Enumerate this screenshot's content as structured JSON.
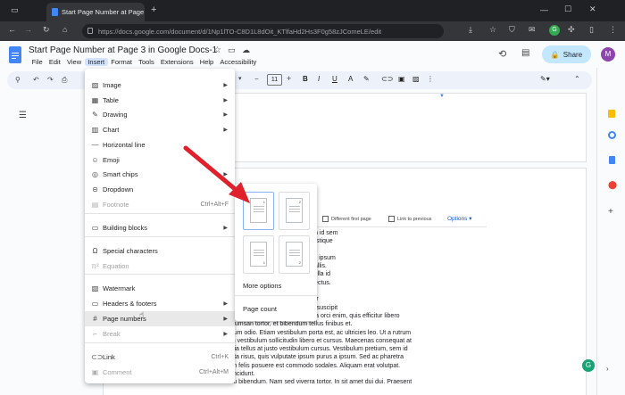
{
  "browser": {
    "tab_title": "Start Page Number at Page 3 in",
    "url": "https://docs.google.com/document/d/1Np1lTO-C8D1L8dOit_KTlfaHd2Hs3F0g58zJComeLE/edit"
  },
  "docs": {
    "title": "Start Page Number at Page 3 in Google Docs-1",
    "share_label": "Share",
    "avatar_letter": "M",
    "font_size": "11",
    "menus": [
      "File",
      "Edit",
      "View",
      "Insert",
      "Format",
      "Tools",
      "Extensions",
      "Help",
      "Accessibility"
    ]
  },
  "insert_menu": {
    "items": [
      {
        "label": "Image",
        "icon": "image-icon",
        "submenu": true
      },
      {
        "label": "Table",
        "icon": "table-icon",
        "submenu": true
      },
      {
        "label": "Drawing",
        "icon": "drawing-icon",
        "submenu": true
      },
      {
        "label": "Chart",
        "icon": "chart-icon",
        "submenu": true
      },
      {
        "label": "Horizontal line",
        "icon": "horizontal-line-icon"
      },
      {
        "label": "Emoji",
        "icon": "emoji-icon"
      },
      {
        "label": "Smart chips",
        "icon": "smart-chips-icon",
        "submenu": true
      },
      {
        "label": "Dropdown",
        "icon": "dropdown-icon"
      },
      {
        "label": "Footnote",
        "icon": "footnote-icon",
        "shortcut": "Ctrl+Alt+F",
        "disabled": true
      },
      {
        "label": "Building blocks",
        "icon": "building-blocks-icon",
        "submenu": true
      },
      {
        "label": "Special characters",
        "icon": "omega-icon"
      },
      {
        "label": "Equation",
        "icon": "equation-icon",
        "disabled": true
      },
      {
        "label": "Watermark",
        "icon": "watermark-icon"
      },
      {
        "label": "Headers & footers",
        "icon": "headers-footers-icon",
        "submenu": true
      },
      {
        "label": "Page numbers",
        "icon": "page-numbers-icon",
        "submenu": true,
        "highlighted": true
      },
      {
        "label": "Break",
        "icon": "break-icon",
        "submenu": true,
        "disabled": true
      },
      {
        "label": "Link",
        "icon": "link-icon",
        "shortcut": "Ctrl+K"
      },
      {
        "label": "Comment",
        "icon": "comment-icon",
        "shortcut": "Ctrl+Alt+M",
        "disabled": true
      }
    ]
  },
  "page_numbers_submenu": {
    "more_options": "More options",
    "page_count": "Page count"
  },
  "header_bar": {
    "different_first_page": "Different first page",
    "link_to_previous": "Link to previous",
    "options": "Options"
  },
  "body_lines": [
    "n at nulla tempor ornare. Aenean id sem",
    "molestie non ante non, iaculis tristique",
    "ellentesque, nisi quis sodales",
    "quam nec justo. Vestibulum ante ipsum",
    "rae; Etiam efficitur congue convallis.",
    "volutpat. Aenean consectetur, nulla id",
    "nibh lacus at libero. In nec orci lectus.",
    "lorem auctor sodales. Quisque a",
    "ipsum dolor sit amet, consectetur",
    "consequat nisl accumsan. Proin suscipit",
    "n lorem facilisis. Phasellus viverra orci enim, quis efficitur libero",
    "accumsan tortor, et bibendum tellus finibus et.",
    "entum odio. Etiam vestibulum porta est, ac ultricies leo. Ut a rutrum",
    "ean vestibulum sollicitudin libero et cursus. Maecenas consequat at",
    "icinia tellus at justo vestibulum cursus. Vestibulum pretium, sem id",
    "porta risus, quis vulputate ipsum purus a ipsum. Sed ac pharetra",
    "m in felis posuere est commodo sodales. Aliquam erat volutpat.",
    "s tincidunt.",
    "Mauris imperdiet aliquet diam eu bibendum. Nam sed viverra tortor. In sit amet dui dui. Praesent"
  ],
  "colors": {
    "accent": "#0b57d0",
    "arrow": "#e0202a",
    "share_bg": "#c2e7ff"
  }
}
